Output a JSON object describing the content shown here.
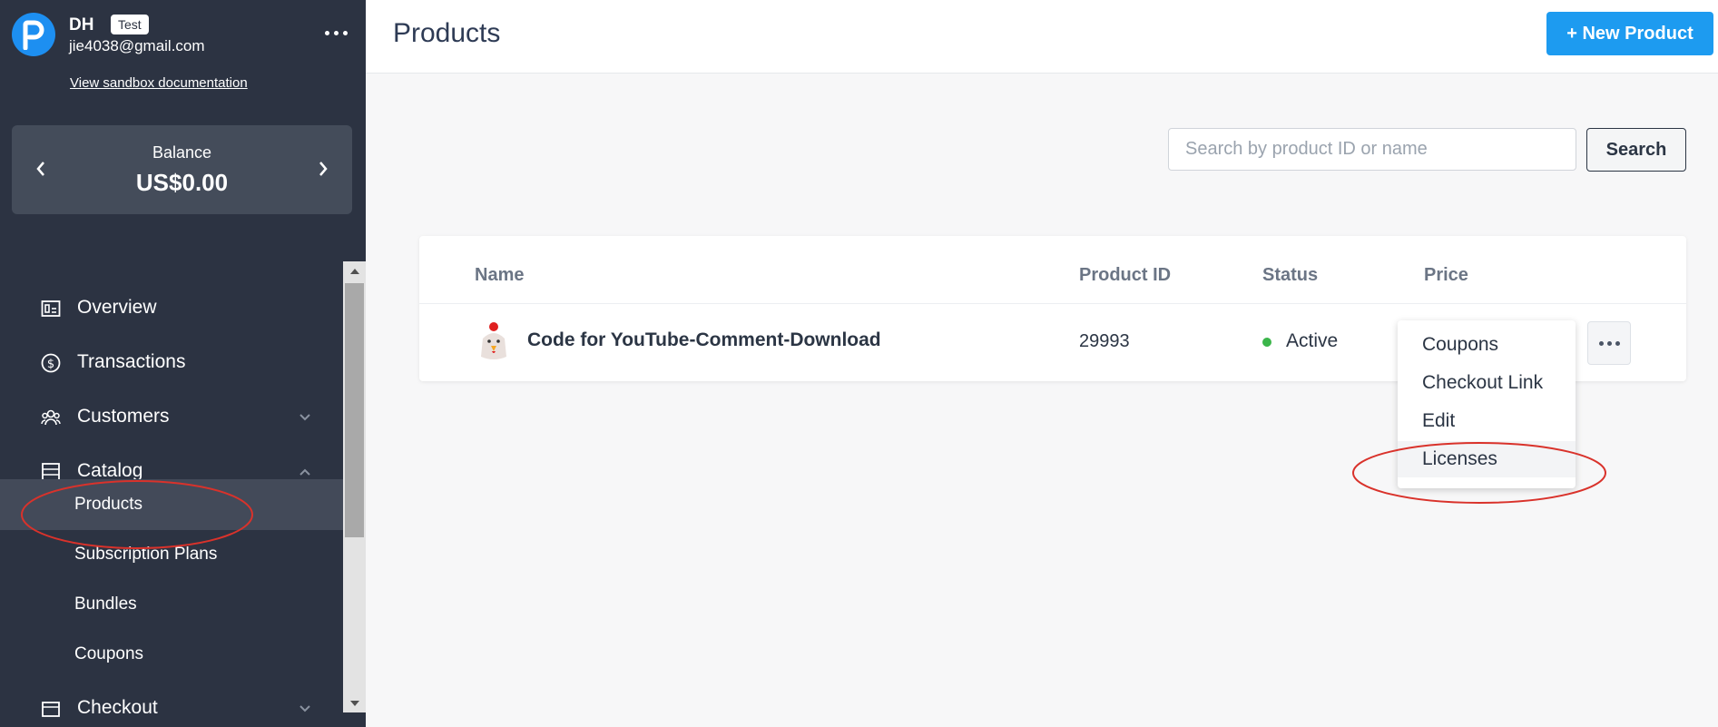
{
  "sidebar": {
    "user_initials": "DH",
    "test_badge": "Test",
    "email": "jie4038@gmail.com",
    "sandbox_link": "View sandbox documentation",
    "balance_label": "Balance",
    "balance_value": "US$0.00",
    "nav": [
      {
        "label": "Overview",
        "icon": "overview-icon"
      },
      {
        "label": "Transactions",
        "icon": "dollar-circle-icon"
      },
      {
        "label": "Customers",
        "icon": "users-icon",
        "expanded": false
      },
      {
        "label": "Catalog",
        "icon": "catalog-icon",
        "expanded": true
      },
      {
        "label": "Checkout",
        "icon": "checkout-icon",
        "expanded": false
      }
    ],
    "catalog_sub": [
      {
        "label": "Products",
        "active": true
      },
      {
        "label": "Subscription Plans"
      },
      {
        "label": "Bundles"
      },
      {
        "label": "Coupons"
      }
    ]
  },
  "header": {
    "title": "Products",
    "new_product_label": "+ New Product"
  },
  "search": {
    "placeholder": "Search by product ID or name",
    "button_label": "Search"
  },
  "table": {
    "columns": [
      "Name",
      "Product ID",
      "Status",
      "Price"
    ],
    "rows": [
      {
        "name": "Code for YouTube-Comment-Download",
        "product_id": "29993",
        "status": "Active",
        "price": "",
        "icon": "chicken-icon"
      }
    ]
  },
  "row_menu": {
    "items": [
      "Coupons",
      "Checkout Link",
      "Edit",
      "Licenses"
    ],
    "highlighted": "Licenses"
  },
  "colors": {
    "sidebar_bg": "#2c3342",
    "accent": "#1d9bf0",
    "status_active": "#3bb54a",
    "annotation": "#d9322b"
  }
}
